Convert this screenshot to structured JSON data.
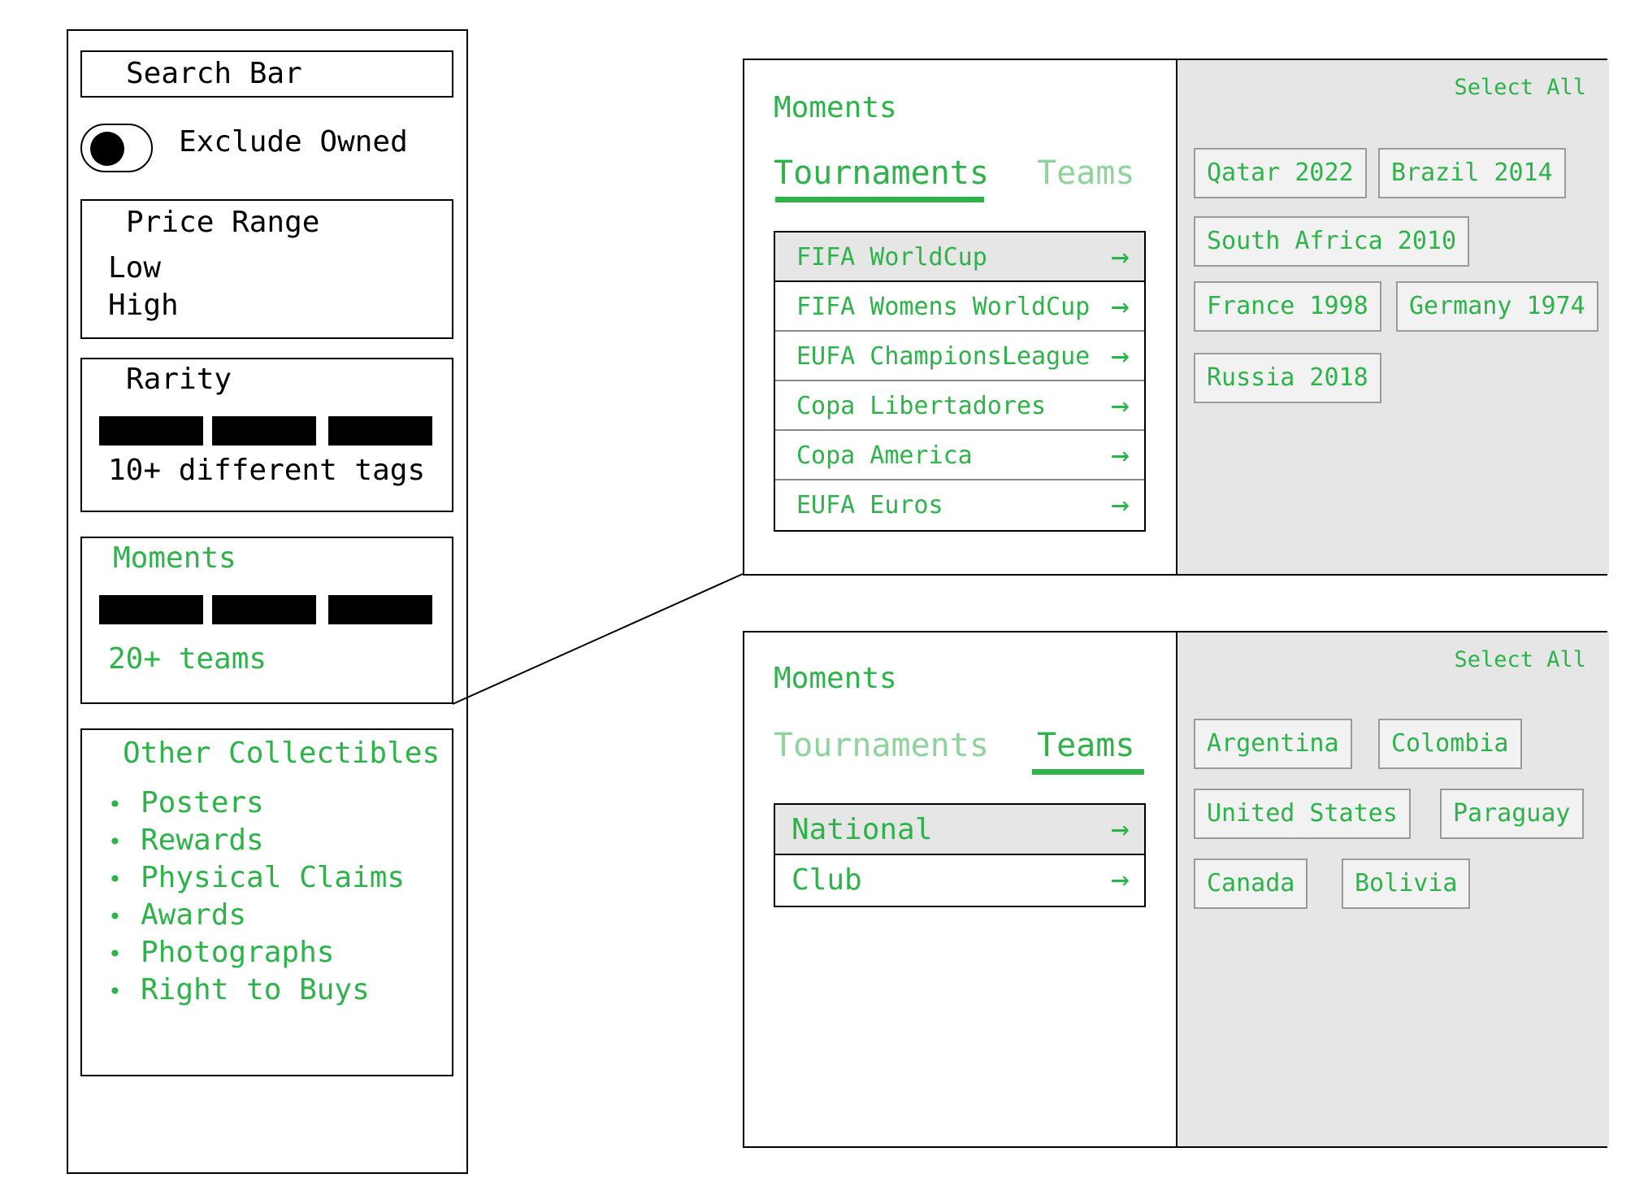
{
  "sidebar": {
    "search_bar": "Search Bar",
    "exclude_owned": "Exclude Owned",
    "price_range": {
      "title": "Price Range",
      "low": "Low",
      "high": "High"
    },
    "rarity": {
      "title": "Rarity",
      "caption": "10+ different tags"
    },
    "moments": {
      "title": "Moments",
      "caption": "20+ teams"
    },
    "other_collectibles": {
      "title": "Other Collectibles",
      "items": [
        "Posters",
        "Rewards",
        "Physical Claims",
        "Awards",
        "Photographs",
        "Right to Buys"
      ]
    }
  },
  "panel_tournaments": {
    "title": "Moments",
    "tabs": [
      "Tournaments",
      "Teams"
    ],
    "active_tab": "Tournaments",
    "select_all": "Select All",
    "list": [
      "FIFA WorldCup",
      "FIFA Womens WorldCup",
      "EUFA ChampionsLeague",
      "Copa Libertadores",
      "Copa America",
      "EUFA Euros"
    ],
    "selected_item": "FIFA WorldCup",
    "chips": [
      "Qatar 2022",
      "Brazil 2014",
      "South Africa 2010",
      "France 1998",
      "Germany 1974",
      "Russia 2018"
    ]
  },
  "panel_teams": {
    "title": "Moments",
    "tabs": [
      "Tournaments",
      "Teams"
    ],
    "active_tab": "Teams",
    "select_all": "Select All",
    "list": [
      "National",
      "Club"
    ],
    "selected_item": "National",
    "chips": [
      "Argentina",
      "Colombia",
      "United States",
      "Paraguay",
      "Canada",
      "Bolivia"
    ]
  },
  "colors": {
    "accent": "#2db34a",
    "inactive": "#8fd49c",
    "panel_bg": "#e6e6e6",
    "border": "#000000"
  },
  "icons": {
    "list_arrow": "right-arrow-icon"
  }
}
